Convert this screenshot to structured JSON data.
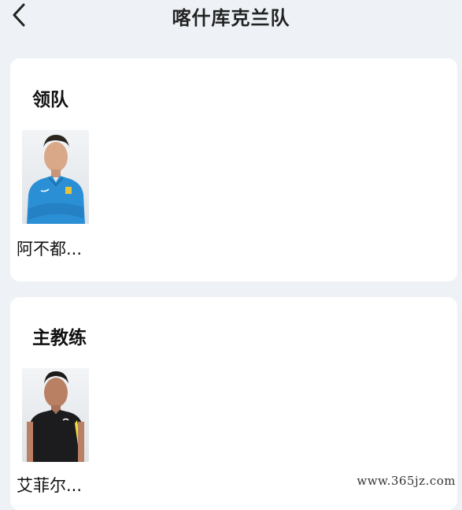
{
  "header": {
    "title": "喀什库克兰队",
    "back_icon": "chevron-left-icon"
  },
  "sections": [
    {
      "title": "领队",
      "people": [
        {
          "name": "阿不都...",
          "photo": "player-photo-blue-jersey"
        }
      ]
    },
    {
      "title": "主教练",
      "people": [
        {
          "name": "艾菲尔...",
          "photo": "player-photo-black-jersey"
        }
      ]
    }
  ],
  "watermark": "www.365jz.com",
  "colors": {
    "background": "#eef2f6",
    "card": "#ffffff",
    "text": "#111111"
  }
}
